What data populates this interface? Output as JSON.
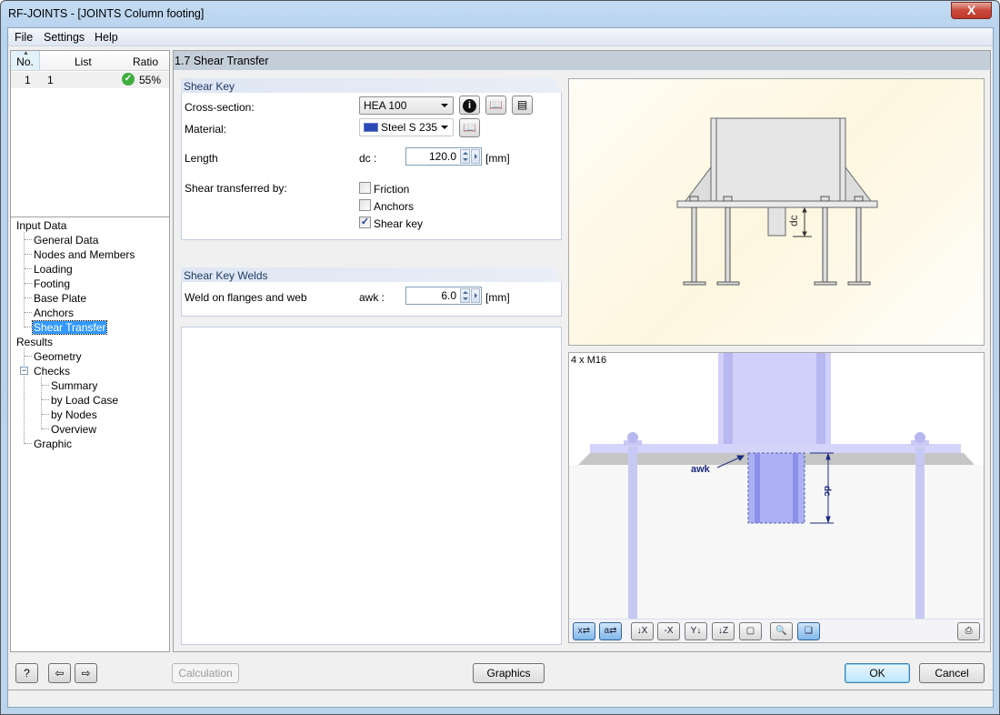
{
  "window": {
    "title": "RF-JOINTS - [JOINTS Column footing]",
    "close_label": "X"
  },
  "menu": [
    "File",
    "Settings",
    "Help"
  ],
  "case_grid": {
    "columns": [
      "No.",
      "List",
      "Ratio"
    ],
    "rows": [
      {
        "no": "1",
        "list": "1",
        "ratio": "55%",
        "status": "ok"
      }
    ]
  },
  "nav": {
    "input_data": "Input Data",
    "input_items": [
      "General Data",
      "Nodes and Members",
      "Loading",
      "Footing",
      "Base Plate",
      "Anchors",
      "Shear Transfer"
    ],
    "results": "Results",
    "geometry": "Geometry",
    "checks": "Checks",
    "checks_items": [
      "Summary",
      "by Load Case",
      "by Nodes",
      "Overview"
    ],
    "graphic": "Graphic",
    "selected": "Shear Transfer",
    "expander": "−"
  },
  "page": {
    "header": "1.7 Shear Transfer"
  },
  "shear_key": {
    "title": "Shear Key",
    "cross_section_label": "Cross-section:",
    "cross_section_value": "HEA 100",
    "material_label": "Material:",
    "material_value": "Steel S 235",
    "length_label": "Length",
    "length_symbol": "dc :",
    "length_value": "120.0",
    "length_unit": "[mm]",
    "shear_by_label": "Shear transferred by:",
    "options": [
      {
        "label": "Friction",
        "checked": false
      },
      {
        "label": "Anchors",
        "checked": false
      },
      {
        "label": "Shear key",
        "checked": true
      }
    ]
  },
  "welds": {
    "title": "Shear Key Welds",
    "label": "Weld on flanges and web",
    "symbol": "awk :",
    "value": "6.0",
    "unit": "[mm]"
  },
  "graphic": {
    "top_dim_label": "dc",
    "bottom_caption": "4 x M16",
    "weld_label": "awk",
    "dim_label": "dc"
  },
  "toolbar": [
    "x",
    "a",
    "X",
    "-X",
    "Y",
    "Z",
    "iso",
    "zoom-off",
    "layers",
    "print"
  ],
  "buttons": {
    "calculation": "Calculation",
    "graphics": "Graphics",
    "ok": "OK",
    "cancel": "Cancel"
  }
}
